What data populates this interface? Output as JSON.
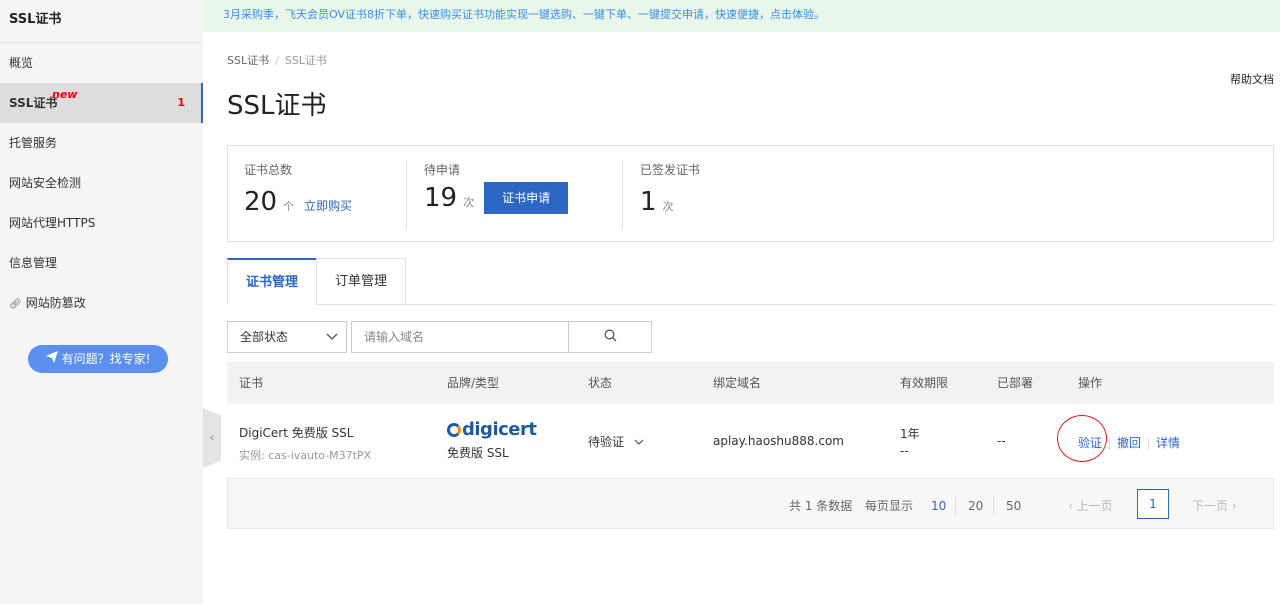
{
  "sidebar": {
    "title": "SSL证书",
    "items": [
      {
        "label": "概览"
      },
      {
        "label": "SSL证书",
        "tag": "new",
        "count": "1"
      },
      {
        "label": "托管服务"
      },
      {
        "label": "网站安全检测"
      },
      {
        "label": "网站代理HTTPS"
      },
      {
        "label": "信息管理"
      },
      {
        "label": "网站防篡改"
      }
    ],
    "expert_button": "有问题？找专家!"
  },
  "banner": {
    "text": "3月采购季，飞天会员OV证书8折下单，快速购买证书功能实现一键选购、一键下单、一键提交申请，快速便捷，点击体验。"
  },
  "breadcrumb": {
    "root": "SSL证书",
    "current": "SSL证书"
  },
  "header": {
    "title": "SSL证书",
    "help": "帮助文档"
  },
  "stats": {
    "total": {
      "label": "证书总数",
      "value": "20",
      "unit": "个",
      "link": "立即购买"
    },
    "pending": {
      "label": "待申请",
      "value": "19",
      "unit": "次",
      "button": "证书申请"
    },
    "issued": {
      "label": "已签发证书",
      "value": "1",
      "unit": "次"
    }
  },
  "tabs": [
    {
      "label": "证书管理"
    },
    {
      "label": "订单管理"
    }
  ],
  "filters": {
    "status_selected": "全部状态",
    "search_placeholder": "请输入域名"
  },
  "table": {
    "headers": [
      "证书",
      "品牌/类型",
      "状态",
      "绑定域名",
      "有效期限",
      "已部署",
      "操作"
    ],
    "rows": [
      {
        "cert_name": "DigiCert 免费版 SSL",
        "instance": "实例: cas-ivauto-M37tPX",
        "brand_logo": "digicert",
        "brand_type": "免费版 SSL",
        "status": "待验证",
        "domain": "aplay.haoshu888.com",
        "validity": "1年",
        "validity_sub": "--",
        "deployed": "--",
        "actions": {
          "verify": "验证",
          "revoke": "撤回",
          "detail": "详情"
        }
      }
    ]
  },
  "pagination": {
    "total_text": "共 1 条数据",
    "per_page_label": "每页显示",
    "sizes": [
      "10",
      "20",
      "50"
    ],
    "selected_size": "10",
    "prev": "上一页",
    "current_page": "1",
    "next": "下一页"
  },
  "colors": {
    "accent": "#2c67c4",
    "banner_bg": "#e9f6ea",
    "highlight_circle": "#d62020"
  }
}
